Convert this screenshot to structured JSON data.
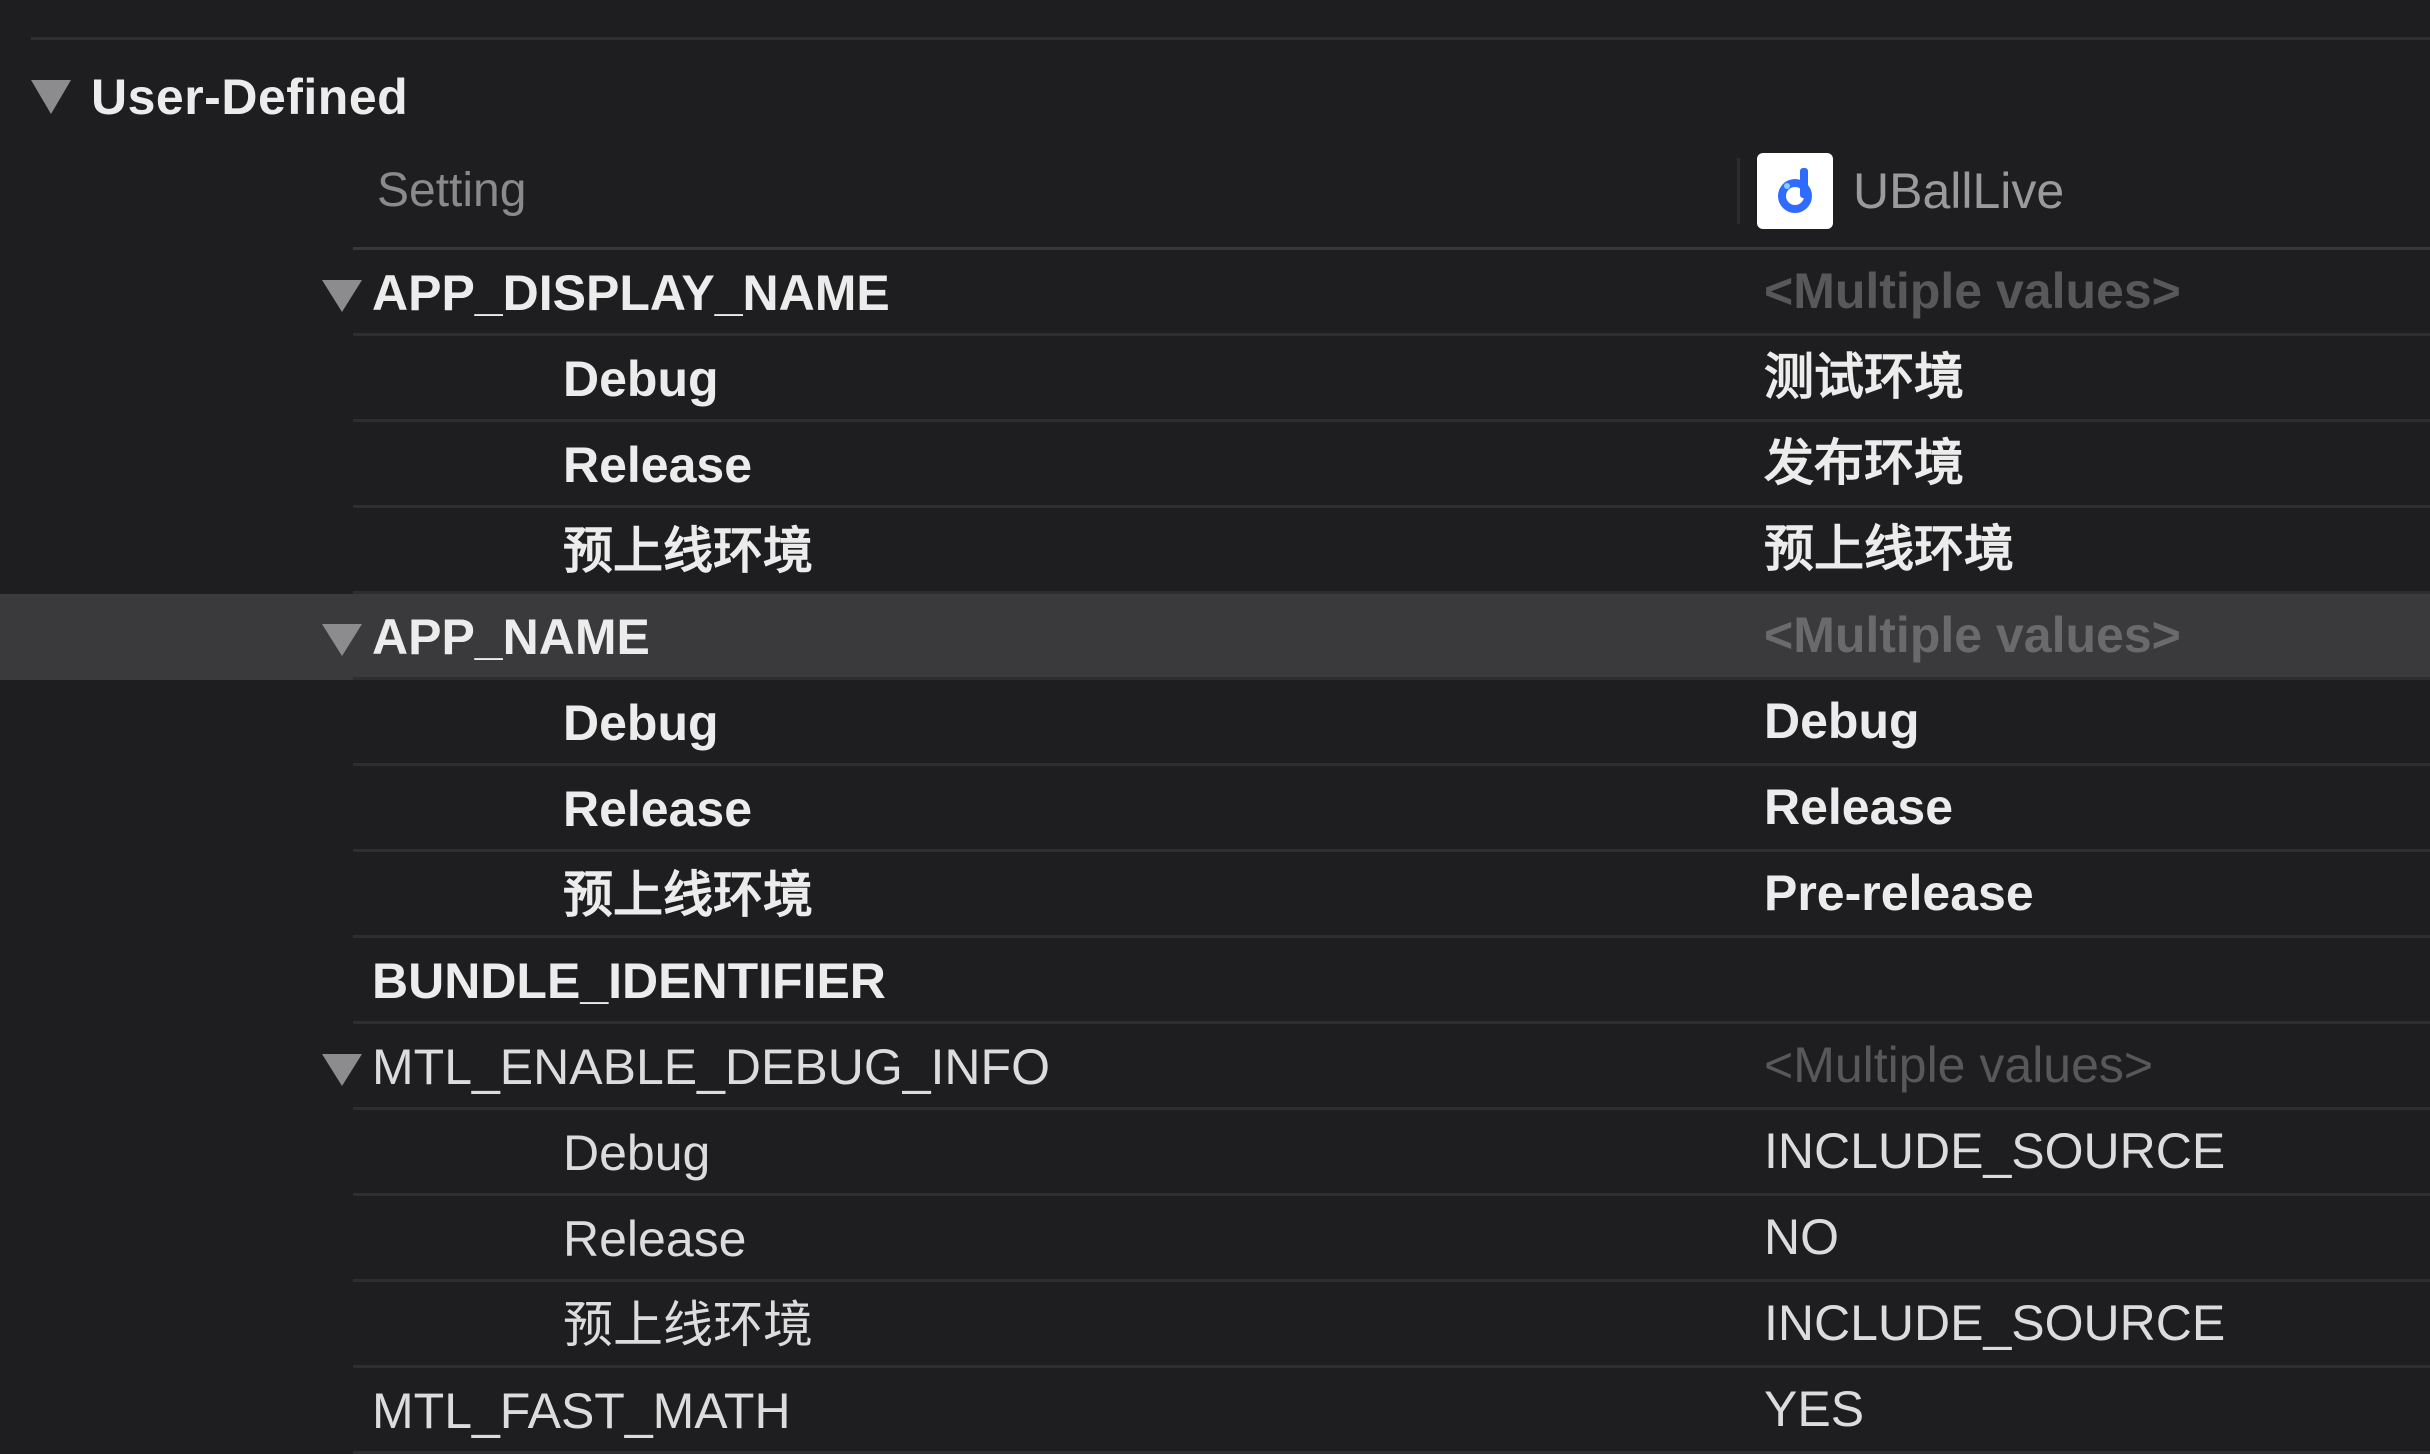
{
  "section": {
    "title": "User-Defined"
  },
  "columns": {
    "setting": "Setting",
    "target": "UBallLive"
  },
  "rows": [
    {
      "name": "APP_DISPLAY_NAME",
      "value": "<Multiple values>"
    },
    {
      "name": "Debug",
      "value": "测试环境"
    },
    {
      "name": "Release",
      "value": "发布环境"
    },
    {
      "name": "预上线环境",
      "value": "预上线环境"
    },
    {
      "name": "APP_NAME",
      "value": "<Multiple values>"
    },
    {
      "name": "Debug",
      "value": "Debug"
    },
    {
      "name": "Release",
      "value": "Release"
    },
    {
      "name": "预上线环境",
      "value": "Pre-release"
    },
    {
      "name": "BUNDLE_IDENTIFIER",
      "value": ""
    },
    {
      "name": "MTL_ENABLE_DEBUG_INFO",
      "value": "<Multiple values>"
    },
    {
      "name": "Debug",
      "value": "INCLUDE_SOURCE"
    },
    {
      "name": "Release",
      "value": "NO"
    },
    {
      "name": "预上线环境",
      "value": "INCLUDE_SOURCE"
    },
    {
      "name": "MTL_FAST_MATH",
      "value": "YES"
    }
  ],
  "selected_row": "APP_NAME",
  "colors": {
    "background": "#1e1e20",
    "selected_row": "#3a3a3c",
    "placeholder_text": "#58585a",
    "icon_accent": "#2f6bff"
  },
  "icons": {
    "disclosure": "disclosure-triangle-down-icon",
    "target": "app-icon"
  }
}
